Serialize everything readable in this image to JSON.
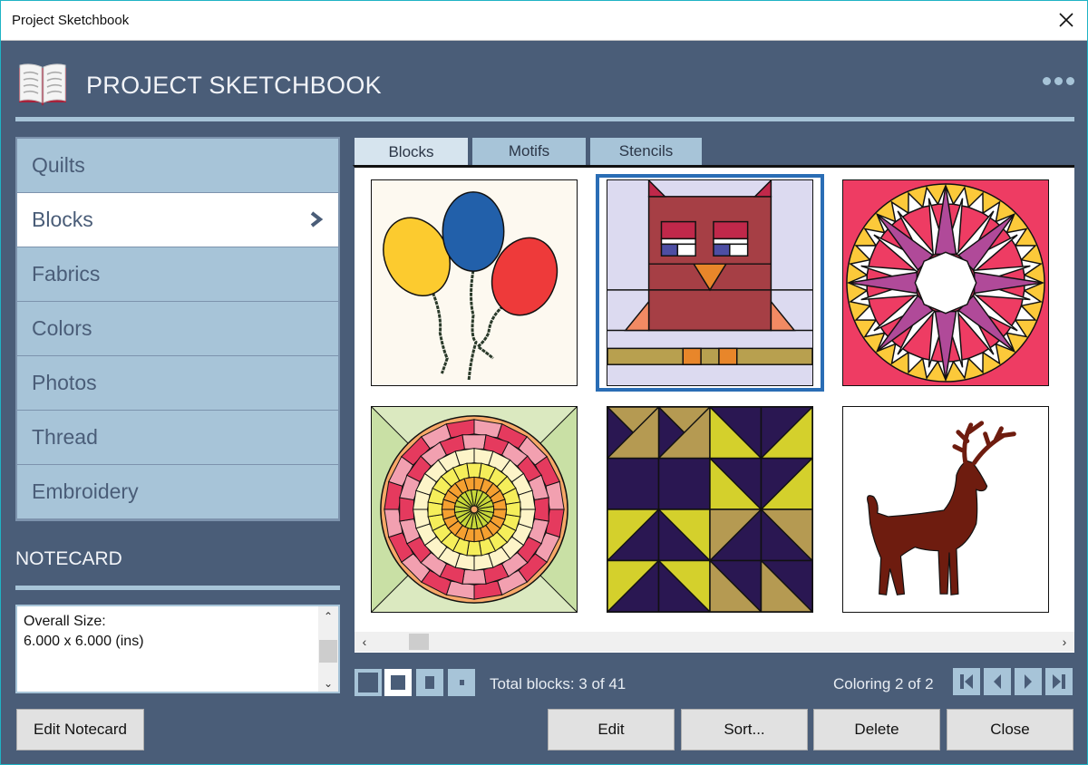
{
  "window": {
    "title": "Project Sketchbook",
    "close_icon": "close-icon"
  },
  "header": {
    "heading": "PROJECT SKETCHBOOK",
    "logo_icon": "open-book-icon",
    "menu_icon": "more-dots-icon"
  },
  "sidebar": {
    "items": [
      {
        "label": "Quilts",
        "active": false
      },
      {
        "label": "Blocks",
        "active": true
      },
      {
        "label": "Fabrics",
        "active": false
      },
      {
        "label": "Colors",
        "active": false
      },
      {
        "label": "Photos",
        "active": false
      },
      {
        "label": "Thread",
        "active": false
      },
      {
        "label": "Embroidery",
        "active": false
      }
    ]
  },
  "notecard": {
    "title": "NOTECARD",
    "line1": "Overall Size:",
    "line2": "6.000 x 6.000 (ins)",
    "edit_label": "Edit Notecard"
  },
  "tabs": [
    {
      "label": "Blocks",
      "active": true
    },
    {
      "label": "Motifs",
      "active": false
    },
    {
      "label": "Stencils",
      "active": false
    }
  ],
  "gallery": {
    "items": [
      {
        "name": "balloons-block",
        "selected": false
      },
      {
        "name": "owl-block",
        "selected": true
      },
      {
        "name": "mariners-compass-block",
        "selected": false
      },
      {
        "name": "dresden-circle-block",
        "selected": false
      },
      {
        "name": "half-square-triangles-block",
        "selected": false
      },
      {
        "name": "reindeer-block",
        "selected": false
      }
    ]
  },
  "footer": {
    "total_blocks": "Total blocks: 3 of 41",
    "coloring": "Coloring 2 of 2",
    "thumbnail_sizes": [
      "extra-large",
      "large",
      "medium",
      "small"
    ],
    "selected_size": "large",
    "nav": [
      "first-icon",
      "previous-icon",
      "next-icon",
      "last-icon"
    ]
  },
  "buttons": {
    "edit": "Edit",
    "sort": "Sort...",
    "delete": "Delete",
    "close": "Close"
  },
  "colors": {
    "background": "#4a5d78",
    "accent": "#a7c4d8",
    "selection": "#2a6db5"
  }
}
